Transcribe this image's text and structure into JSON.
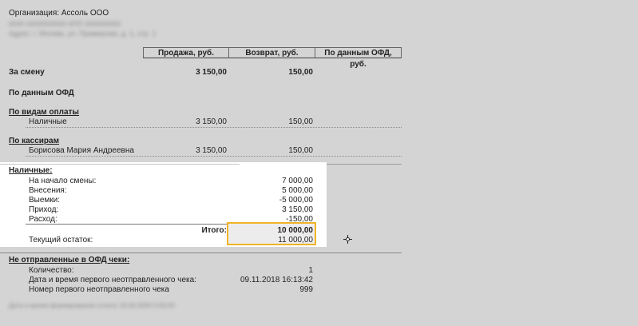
{
  "org": "Организация: Ассоль ООО",
  "blurred": {
    "line1": "ИНН 0000000000 КПП 000000000",
    "line2": "Адрес: г. Москва, ул. Примерная, д. 1, стр. 1",
    "footer": "Дата и время формирования отчета: 00.00.0000 0:00:00"
  },
  "columns": [
    "Продажа, руб.",
    "Возврат, руб.",
    "По данным ОФД, руб."
  ],
  "shift": {
    "label": "За смену",
    "sale": "3 150,00",
    "return": "150,00"
  },
  "ofd_title": "По данным ОФД",
  "payment": {
    "title": "По видам оплаты",
    "rows": [
      {
        "name": "Наличные",
        "sale": "3 150,00",
        "return": "150,00"
      }
    ]
  },
  "cashiers": {
    "title": "По кассирам",
    "rows": [
      {
        "name": "Борисова Мария Андреевна",
        "sale": "3 150,00",
        "return": "150,00"
      }
    ]
  },
  "cash": {
    "title": "Наличные:",
    "rows": [
      {
        "label": "На начало смены:",
        "value": "7 000,00"
      },
      {
        "label": "Внесения:",
        "value": "5 000,00"
      },
      {
        "label": "Выемки:",
        "value": "-5 000,00"
      },
      {
        "label": "Приход:",
        "value": "3 150,00"
      },
      {
        "label": "Расход:",
        "value": "-150,00"
      }
    ],
    "total_label": "Итого:",
    "total_value": "10 000,00",
    "balance_label": "Текущий остаток:",
    "balance_value": "11 000,00"
  },
  "unsent": {
    "title": "Не отправленные в ОФД чеки:",
    "rows": [
      {
        "label": "Количество:",
        "value": "1"
      },
      {
        "label": "Дата и время первого неотправленного чека:",
        "value": "09.11.2018 16:13:42"
      },
      {
        "label": "Номер первого неотправленного чека",
        "value": "999"
      }
    ]
  },
  "icons": {
    "cursor": "crosshair-cursor-icon"
  }
}
